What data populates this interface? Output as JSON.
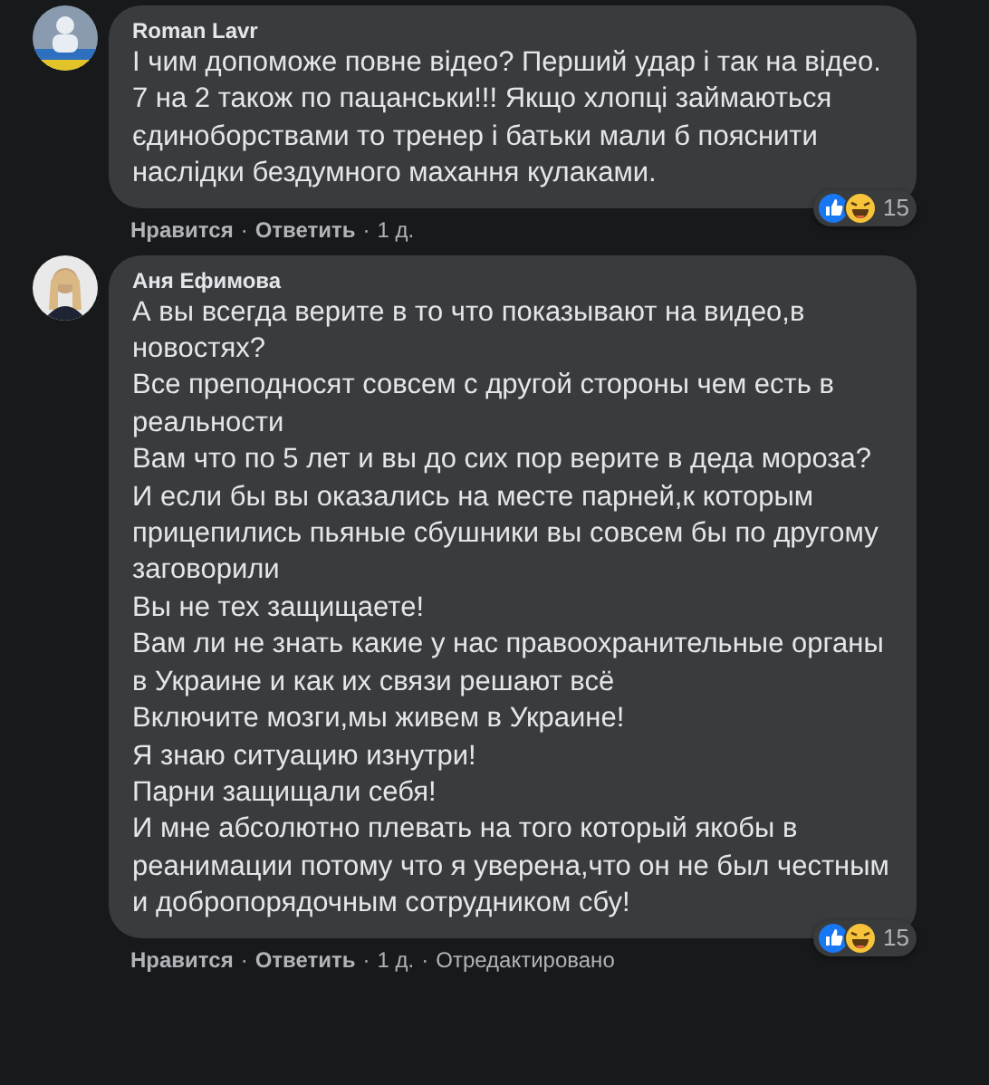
{
  "separator": "·",
  "comments": [
    {
      "author": "Roman Lavr",
      "paragraphs": [
        "І чим допоможе повне відео? Перший удар і так на відео. 7 на 2 також по пацанськи!!! Якщо хлопці займаються єдиноборствами то тренер і батьки мали б пояснити наслідки бездумного махання кулаками."
      ],
      "reaction_count": "15",
      "actions": [
        {
          "kind": "action",
          "text": "Нравится"
        },
        {
          "kind": "action",
          "text": "Ответить"
        },
        {
          "kind": "time",
          "text": "1 д."
        }
      ]
    },
    {
      "author": "Аня Ефимова",
      "paragraphs": [
        "А вы всегда верите в то что показывают на видео,в новостях?",
        "Все преподносят совсем с другой стороны чем есть в реальности",
        "Вам что по 5 лет и вы до сих пор верите в деда мороза?",
        "И если бы вы оказались на месте парней,к которым прицепились пьяные сбушники вы совсем бы по другому заговорили",
        "Вы не тех защищаете!",
        "Вам ли не знать какие у нас правоохранительные органы в Украине и как их связи решают всё",
        "Включите мозги,мы живем в Украине!",
        "Я знаю ситуацию изнутри!",
        "Парни защищали себя!",
        "И мне абсолютно плевать на того который якобы в реанимации потому что я уверена,что он не был честным и добропорядочным сотрудником сбу!"
      ],
      "reaction_count": "15",
      "actions": [
        {
          "kind": "action",
          "text": "Нравится"
        },
        {
          "kind": "action",
          "text": "Ответить"
        },
        {
          "kind": "time",
          "text": "1 д."
        },
        {
          "kind": "time",
          "text": "Отредактировано"
        }
      ]
    }
  ]
}
